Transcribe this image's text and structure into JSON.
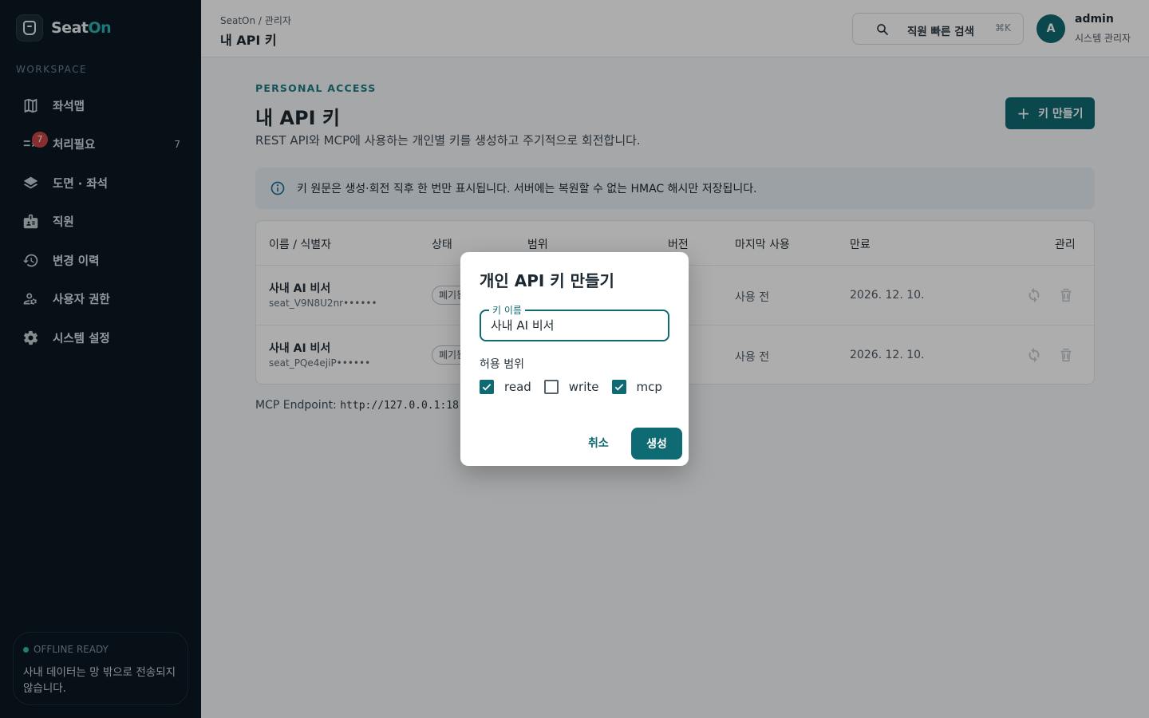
{
  "brand": {
    "name_prefix": "Seat",
    "name_suffix": "On"
  },
  "sidebar": {
    "section_label": "WORKSPACE",
    "items": [
      {
        "label": "좌석맵",
        "icon": "map-icon"
      },
      {
        "label": "처리필요",
        "icon": "checklist-icon",
        "badge": "7",
        "count": "7"
      },
      {
        "label": "도면 · 좌석",
        "icon": "layers-icon"
      },
      {
        "label": "직원",
        "icon": "badge-icon"
      },
      {
        "label": "변경 이력",
        "icon": "history-icon"
      },
      {
        "label": "사용자 권한",
        "icon": "user-settings-icon"
      },
      {
        "label": "시스템 설정",
        "icon": "gear-icon"
      }
    ],
    "offline": {
      "title": "OFFLINE READY",
      "message": "사내 데이터는 망 밖으로 전송되지 않습니다."
    }
  },
  "topbar": {
    "breadcrumb": "SeatOn / 관리자",
    "title": "내 API 키",
    "search_placeholder": "직원 빠른 검색",
    "search_shortcut": "⌘K",
    "user": {
      "initial": "A",
      "name": "admin",
      "role": "시스템 관리자"
    }
  },
  "main": {
    "eyebrow": "PERSONAL ACCESS",
    "title": "내 API 키",
    "subtitle": "REST API와 MCP에 사용하는 개인별 키를 생성하고 주기적으로 회전합니다.",
    "create_button": "키 만들기",
    "notice": "키 원문은 생성·회전 직후 한 번만 표시됩니다. 서버에는 복원할 수 없는 HMAC 해시만 저장됩니다.",
    "table": {
      "headers": [
        "이름 / 식별자",
        "상태",
        "범위",
        "버전",
        "마지막 사용",
        "만료",
        "관리"
      ],
      "rows": [
        {
          "name": "사내 AI 비서",
          "id": "seat_V9N8U2nr••••••",
          "status": "폐기됨",
          "last_used": "사용 전",
          "expires": "2026. 12. 10."
        },
        {
          "name": "사내 AI 비서",
          "id": "seat_PQe4ejiP••••••",
          "status": "폐기됨",
          "last_used": "사용 전",
          "expires": "2026. 12. 10."
        }
      ]
    },
    "endpoint_label": "MCP Endpoint:",
    "endpoint_value": "http://127.0.0.1:18"
  },
  "dialog": {
    "title": "개인 API 키 만들기",
    "name_label": "키 이름",
    "name_value": "사내 AI 비서",
    "scope_label": "허용 범위",
    "scopes": [
      {
        "label": "read",
        "checked": true
      },
      {
        "label": "write",
        "checked": false
      },
      {
        "label": "mcp",
        "checked": true
      }
    ],
    "cancel": "취소",
    "submit": "생성"
  },
  "colors": {
    "accent": "#0f6b73",
    "sidebar_bg": "#0b1821",
    "badge": "#c94545"
  }
}
